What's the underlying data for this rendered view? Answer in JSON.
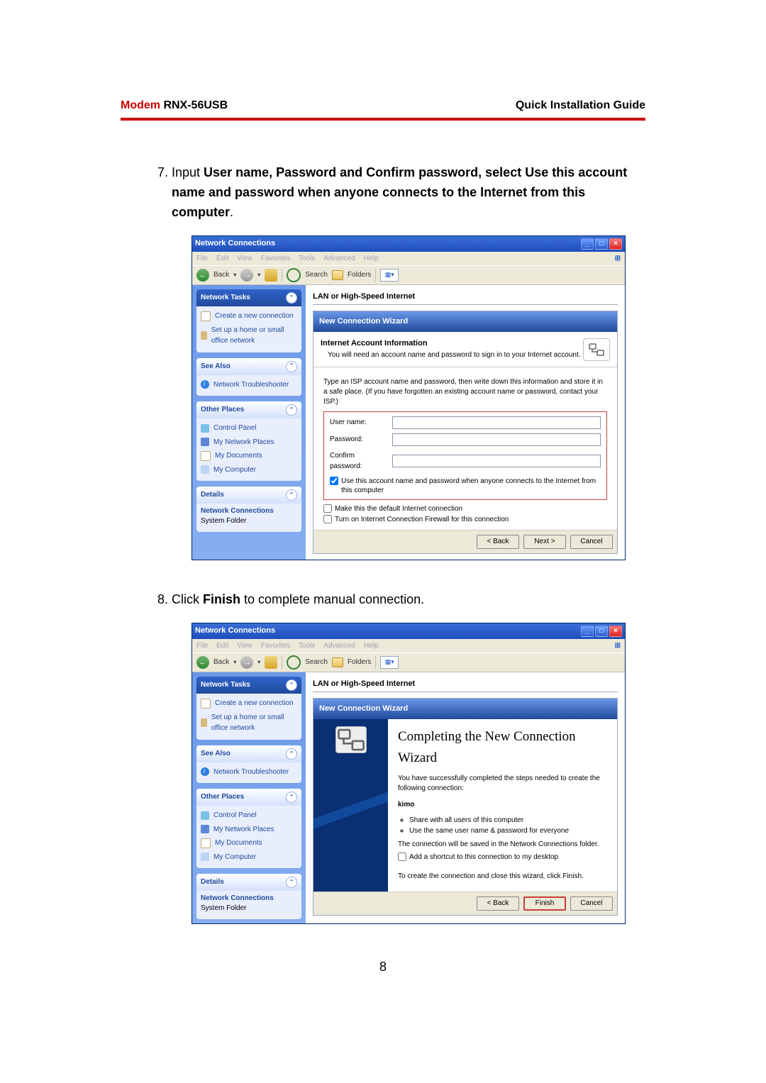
{
  "header": {
    "modem_label": "Modem",
    "model": " RNX-56USB",
    "guide": "Quick  Installation  Guide"
  },
  "steps": {
    "s7_pre": "Input ",
    "s7_bold": "User name, Password and Confirm password, select Use this account name and password when anyone connects to the Internet from this computer",
    "s7_post": ".",
    "s8_pre": "Click ",
    "s8_bold": "Finish",
    "s8_post": " to complete manual connection."
  },
  "win": {
    "title": "Network Connections",
    "menu": {
      "file": "File",
      "edit": "Edit",
      "view": "View",
      "favorites": "Favorites",
      "tools": "Tools",
      "advanced": "Advanced",
      "help": "Help"
    },
    "toolbar": {
      "back": "Back",
      "search": "Search",
      "folders": "Folders"
    },
    "group_header": "LAN or High-Speed Internet",
    "side": {
      "tasks": {
        "title": "Network Tasks",
        "create": "Create a new connection",
        "setup": "Set up a home or small office network"
      },
      "seealso": {
        "title": "See Also",
        "trouble": "Network Troubleshooter"
      },
      "other": {
        "title": "Other Places",
        "cp": "Control Panel",
        "mnp": "My Network Places",
        "docs": "My Documents",
        "mycmp": "My Computer"
      },
      "details": {
        "title": "Details",
        "name": "Network Connections",
        "type": "System Folder"
      }
    }
  },
  "wiz1": {
    "title": "New Connection Wizard",
    "head_title": "Internet Account Information",
    "head_sub": "You will need an account name and password to sign in to your Internet account.",
    "instr": "Type an ISP account name and password, then write down this information and store it in a safe place. (If you have forgotten an existing account name or password, contact your ISP.)",
    "lbl_user": "User name:",
    "lbl_pw": "Password:",
    "lbl_cpw": "Confirm password:",
    "chk1": "Use this account  name  and password when anyone connects to the Internet from this computer",
    "chk2": "Make this the default Internet connection",
    "chk3": "Turn on Internet Connection Firewall for this connection",
    "btn_back": "< Back",
    "btn_next": "Next >",
    "btn_cancel": "Cancel"
  },
  "wiz2": {
    "title": "New Connection Wizard",
    "heading": "Completing the New Connection Wizard",
    "p1": "You have successfully completed the steps needed to create the following connection:",
    "conn_name": "kimo",
    "bul1": "Share with all users of this computer",
    "bul2": "Use the same user name & password for everyone",
    "p2": "The connection will be saved in the Network Connections folder.",
    "chk_shortcut": "Add a shortcut to this connection to my desktop",
    "p3": "To create the connection and close this wizard, click Finish.",
    "btn_back": "< Back",
    "btn_finish": "Finish",
    "btn_cancel": "Cancel"
  },
  "page_number": "8"
}
